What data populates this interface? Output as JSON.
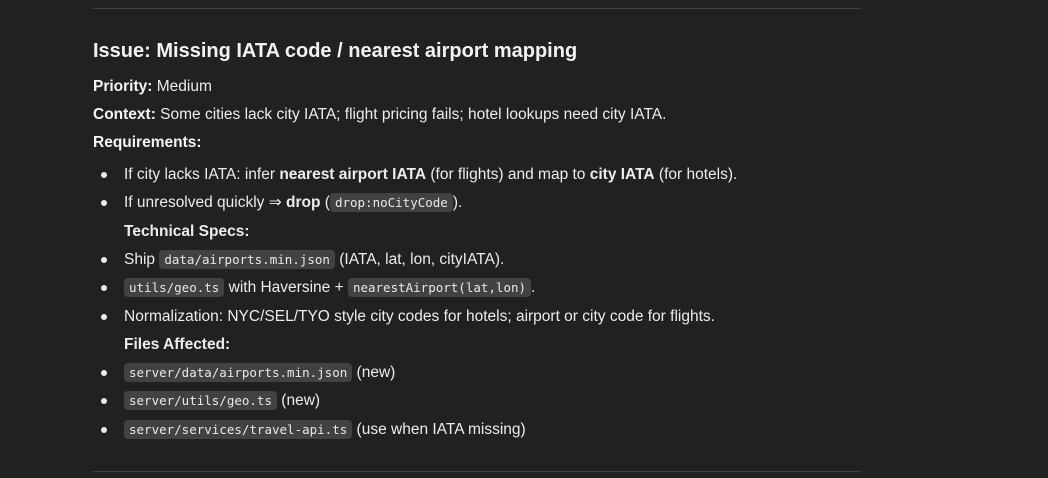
{
  "issue": {
    "title": "Issue: Missing IATA code / nearest airport mapping",
    "priority_label": "Priority:",
    "priority_value": "Medium",
    "context_label": "Context:",
    "context_value": "Some cities lack city IATA; flight pricing fails; hotel lookups need city IATA.",
    "requirements_label": "Requirements:",
    "requirements": [
      {
        "t1": "If city lacks IATA: infer ",
        "b1": "nearest airport IATA",
        "t2": " (for flights) and map to ",
        "b2": "city IATA",
        "t3": " (for hotels)."
      },
      {
        "t1": "If unresolved quickly ⇒ ",
        "b1": "drop",
        "t2": " (",
        "code": "drop:noCityCode",
        "t3": ")."
      }
    ],
    "tech_specs_label": "Technical Specs:",
    "tech_specs": [
      {
        "t1": "Ship ",
        "code": "data/airports.min.json",
        "t2": " (IATA, lat, lon, cityIATA)."
      },
      {
        "code1": "utils/geo.ts",
        "t1": " with Haversine + ",
        "code2": "nearestAirport(lat,lon)",
        "t2": "."
      },
      {
        "t1": "Normalization: NYC/SEL/TYO style city codes for hotels; airport or city code for flights."
      }
    ],
    "files_label": "Files Affected:",
    "files": [
      {
        "code": "server/data/airports.min.json",
        "note": " (new)"
      },
      {
        "code": "server/utils/geo.ts",
        "note": " (new)"
      },
      {
        "code": "server/services/travel-api.ts",
        "note": " (use when IATA missing)"
      }
    ]
  }
}
